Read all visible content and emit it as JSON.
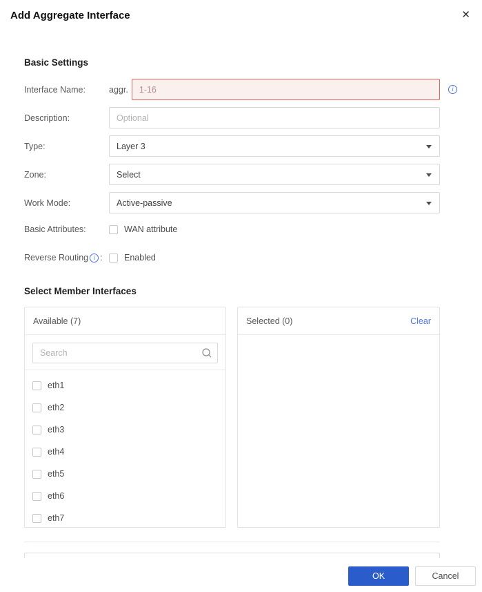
{
  "dialog": {
    "title": "Add Aggregate Interface"
  },
  "icons": {
    "close": "✕",
    "info": "i"
  },
  "basic_settings": {
    "heading": "Basic Settings",
    "interface_name": {
      "label": "Interface Name:",
      "prefix": "aggr.",
      "value": "",
      "placeholder": "1-16",
      "state": "error"
    },
    "description": {
      "label": "Description:",
      "value": "",
      "placeholder": "Optional"
    },
    "type": {
      "label": "Type:",
      "value": "Layer 3"
    },
    "zone": {
      "label": "Zone:",
      "value": "Select"
    },
    "work_mode": {
      "label": "Work Mode:",
      "value": "Active-passive"
    },
    "basic_attributes": {
      "label": "Basic Attributes:",
      "checkbox_label": "WAN attribute",
      "checked": false
    },
    "reverse_routing": {
      "label": "Reverse Routing",
      "label_suffix": ":",
      "checkbox_label": "Enabled",
      "checked": false
    }
  },
  "member_interfaces": {
    "heading": "Select Member Interfaces",
    "available": {
      "title": "Available (7)",
      "search_placeholder": "Search",
      "items": [
        "eth1",
        "eth2",
        "eth3",
        "eth4",
        "eth5",
        "eth6",
        "eth7"
      ],
      "items_checked": [
        false,
        false,
        false,
        false,
        false,
        false,
        false
      ]
    },
    "selected": {
      "title": "Selected (0)",
      "clear_label": "Clear",
      "items": []
    }
  },
  "footer": {
    "ok_label": "OK",
    "cancel_label": "Cancel"
  },
  "colors": {
    "primary_button": "#2b5ccc",
    "link_blue": "#4d78f0",
    "info_icon_blue": "#4d6fe0",
    "error_border": "#e06459",
    "error_background": "#faf0ee",
    "input_border": "#d9d9d9"
  }
}
